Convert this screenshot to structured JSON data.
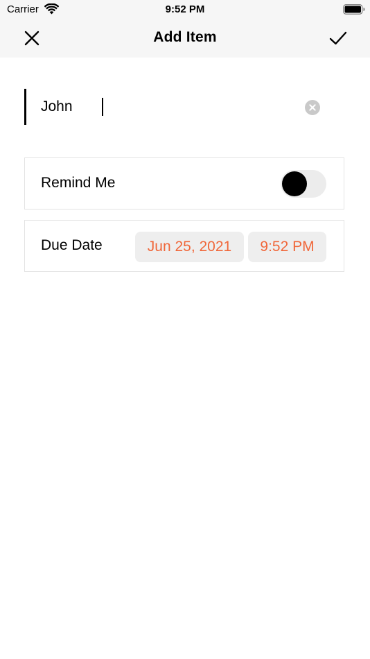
{
  "status_bar": {
    "carrier": "Carrier",
    "time": "9:52 PM"
  },
  "nav": {
    "title": "Add Item",
    "close_icon": "close-icon",
    "confirm_icon": "checkmark-icon"
  },
  "item_field": {
    "value": "John",
    "clear_icon": "clear-circle-icon"
  },
  "remind": {
    "label": "Remind Me",
    "enabled": false
  },
  "due_date": {
    "label": "Due Date",
    "date": "Jun 25, 2021",
    "time": "9:52 PM"
  },
  "colors": {
    "accent": "#f0673a",
    "nav_background": "#f6f6f6",
    "pill_background": "#eeeeee",
    "toggle_track": "#ececec"
  }
}
